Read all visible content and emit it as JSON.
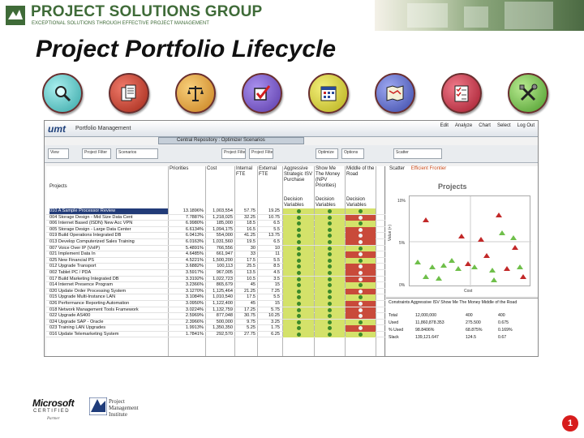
{
  "header": {
    "company": "PROJECT SOLUTIONS GROUP",
    "tagline": "EXCEPTIONAL SOLUTIONS THROUGH EFFECTIVE PROJECT MANAGEMENT"
  },
  "slide_title": "Project Portfolio Lifecycle",
  "phase_icons": [
    {
      "name": "magnifier-icon",
      "color": "#5cc8c8"
    },
    {
      "name": "documents-icon",
      "color": "#c43b2c"
    },
    {
      "name": "scales-icon",
      "color": "#e9a63a"
    },
    {
      "name": "checkbox-icon",
      "color": "#7b5ac8"
    },
    {
      "name": "calendar-icon",
      "color": "#d8d23a"
    },
    {
      "name": "map-icon",
      "color": "#5e6cc9"
    },
    {
      "name": "checklist-icon",
      "color": "#c8354a"
    },
    {
      "name": "tools-icon",
      "color": "#7dbf55"
    }
  ],
  "app": {
    "brand": "umt",
    "brand_sub": "Portfolio Management",
    "menu": [
      "Edit",
      "Analyze",
      "Chart",
      "Select",
      "Log Out"
    ],
    "tab_label": "Central Repository : Optimizer Scenarios",
    "toolbar_items": [
      "View",
      "Project Filter",
      "Scenarios",
      "Project Filter",
      "Project Filter",
      "Optimize",
      "Options",
      "Scatter"
    ],
    "columns": [
      "Priorities",
      "Cost",
      "Internal FTE",
      "External FTE",
      "Aggressive Strategic ISV Purchase",
      "Show Me The Money (NPV Priorities)",
      "Middle of the Road"
    ],
    "projects_header": "Projects",
    "decision_header": "Decision Variables",
    "projects": [
      {
        "name": "010  A Sample Processor Review",
        "priority": "13.1896%",
        "cost": "1,003,554",
        "ifte": "57.75",
        "efte": "19.25",
        "selected": true
      },
      {
        "name": "004  Storage Design - Mid Size Data Cent",
        "priority": "7.7887%",
        "cost": "1,218,025",
        "ifte": "32.25",
        "efte": "10.75"
      },
      {
        "name": "006  Internet Based (ISDN) New Acc VPN",
        "priority": "6.9980%",
        "cost": "185,000",
        "ifte": "18.5",
        "efte": "6.5"
      },
      {
        "name": "005  Storage Design - Large Data Center",
        "priority": "6.6134%",
        "cost": "1,094,175",
        "ifte": "16.5",
        "efte": "5.5"
      },
      {
        "name": "019  Build Operations Integrated DB",
        "priority": "6.0413%",
        "cost": "554,000",
        "ifte": "41.25",
        "efte": "13.75"
      },
      {
        "name": "013  Develop Computerized Sales Training",
        "priority": "6.0163%",
        "cost": "1,031,560",
        "ifte": "19.5",
        "efte": "6.5"
      },
      {
        "name": "007  Voice Over IP (VoIP)",
        "priority": "5.4891%",
        "cost": "766,556",
        "ifte": "30",
        "efte": "10"
      },
      {
        "name": "021  Implement Data In",
        "priority": "4.6485%",
        "cost": "661,947",
        "ifte": "33",
        "efte": "11"
      },
      {
        "name": "025  New Financial PS",
        "priority": "4.5221%",
        "cost": "1,500,200",
        "ifte": "17.5",
        "efte": "5.5"
      },
      {
        "name": "012  Upgrade Transport",
        "priority": "3.6882%",
        "cost": "100,113",
        "ifte": "25.5",
        "efte": "8.5"
      },
      {
        "name": "002  Tablet PC / PDA",
        "priority": "3.5917%",
        "cost": "967,005",
        "ifte": "13.5",
        "efte": "4.5"
      },
      {
        "name": "017  Build Marketing Integrated DB",
        "priority": "3.3192%",
        "cost": "1,022,723",
        "ifte": "10.5",
        "efte": "3.5"
      },
      {
        "name": "014  Internet Presence Program",
        "priority": "3.2366%",
        "cost": "865,679",
        "ifte": "45",
        "efte": "15"
      },
      {
        "name": "020  Update Order Processing System",
        "priority": "3.1270%",
        "cost": "1,125,464",
        "ifte": "21.25",
        "efte": "7.25"
      },
      {
        "name": "015  Upgrade Multi-Instance LAN",
        "priority": "3.1084%",
        "cost": "1,010,540",
        "ifte": "17.5",
        "efte": "5.5"
      },
      {
        "name": "026  Performance Reporting Automation",
        "priority": "3.0950%",
        "cost": "1,122,400",
        "ifte": "45",
        "efte": "15"
      },
      {
        "name": "018  Network Management Tools Framework",
        "priority": "3.0224%",
        "cost": "1,132,759",
        "ifte": "17.25",
        "efte": "5.75"
      },
      {
        "name": "022  Upgrade AS400",
        "priority": "2.5969%",
        "cost": "877,048",
        "ifte": "30.75",
        "efte": "10.25"
      },
      {
        "name": "024  Upgrade SAP - Oracle",
        "priority": "2.3966%",
        "cost": "500,000",
        "ifte": "9.75",
        "efte": "3.25"
      },
      {
        "name": "023  Training LAN Upgrades",
        "priority": "1.9913%",
        "cost": "1,350,350",
        "ifte": "5.25",
        "efte": "1.75"
      },
      {
        "name": "016  Update Telemarketing System",
        "priority": "1.7841%",
        "cost": "292,570",
        "ifte": "27.75",
        "efte": "6.25"
      }
    ],
    "scatter": {
      "tabs": [
        "Scatter",
        "Efficient Frontier"
      ],
      "title": "Projects",
      "xlabel": "Cost",
      "ylabel": "Value (+)",
      "yticks": [
        "10%",
        "5%",
        "0%"
      ]
    },
    "summary": {
      "header": "Constraints   Aggressive ISV   Show Me The Money   Middle of the Road",
      "rows": [
        [
          "Total",
          "12,000,000",
          "400",
          "400"
        ],
        [
          "Used",
          "11,860,878.353",
          "275.500",
          "0.675"
        ],
        [
          "% Used",
          "98.8406%",
          "68.875%",
          "0.169%"
        ],
        [
          "Slack",
          "139,121.647",
          "124.5",
          "0.67"
        ]
      ]
    }
  },
  "footer": {
    "ms_brand": "Microsoft",
    "ms_cert": "CERTIFIED",
    "ms_partner": "Partner",
    "pmi_text": [
      "Project",
      "Management",
      "Institute"
    ],
    "page_number": "1"
  }
}
